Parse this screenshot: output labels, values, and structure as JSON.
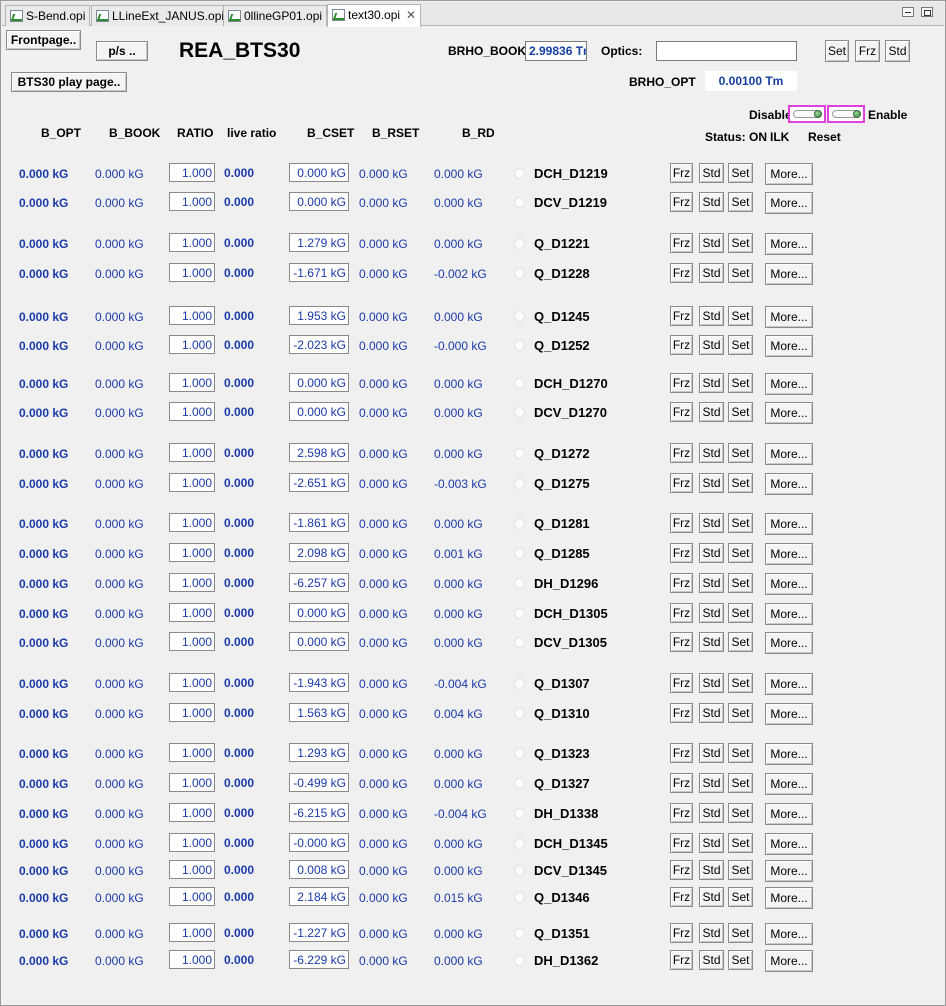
{
  "tabs": [
    {
      "label": "S-Bend.opi"
    },
    {
      "label": "LLineExt_JANUS.opi"
    },
    {
      "label": "0llineGP01.opi"
    },
    {
      "label": "text30.opi"
    }
  ],
  "header": {
    "frontpage_label": "Frontpage..",
    "ps_label": "p/s ..",
    "title": "REA_BTS30",
    "play_page_label": "BTS30 play page..",
    "brho_book_label": "BRHO_BOOK",
    "brho_book_value": "2.99836 Tm",
    "optics_label": "Optics:",
    "optics_value": "",
    "set_label": "Set",
    "frz_label": "Frz",
    "std_label": "Std",
    "brho_opt_label": "BRHO_OPT",
    "brho_opt_value": "0.00100 Tm",
    "disable_label": "Disable",
    "enable_label": "Enable",
    "status_label": "Status: ON",
    "ilk_label": "ILK",
    "reset_label": "Reset"
  },
  "columns": [
    "B_OPT",
    "B_BOOK",
    "RATIO",
    "live ratio",
    "B_CSET",
    "B_RSET",
    "B_RD"
  ],
  "row_buttons": {
    "frz": "Frz",
    "std": "Std",
    "set": "Set",
    "more": "More..."
  },
  "rows": [
    {
      "b_opt": "0.000 kG",
      "b_book": "0.000 kG",
      "ratio": "1.000",
      "live": "0.000",
      "cset": "0.000 kG",
      "rset": "0.000 kG",
      "rd": "0.000 kG",
      "name": "DCH_D1219"
    },
    {
      "b_opt": "0.000 kG",
      "b_book": "0.000 kG",
      "ratio": "1.000",
      "live": "0.000",
      "cset": "0.000 kG",
      "rset": "0.000 kG",
      "rd": "0.000 kG",
      "name": "DCV_D1219"
    },
    {
      "b_opt": "0.000 kG",
      "b_book": "0.000 kG",
      "ratio": "1.000",
      "live": "0.000",
      "cset": "1.279 kG",
      "rset": "0.000 kG",
      "rd": "0.000 kG",
      "name": "Q_D1221"
    },
    {
      "b_opt": "0.000 kG",
      "b_book": "0.000 kG",
      "ratio": "1.000",
      "live": "0.000",
      "cset": "-1.671 kG",
      "rset": "0.000 kG",
      "rd": "-0.002 kG",
      "name": "Q_D1228"
    },
    {
      "b_opt": "0.000 kG",
      "b_book": "0.000 kG",
      "ratio": "1.000",
      "live": "0.000",
      "cset": "1.953 kG",
      "rset": "0.000 kG",
      "rd": "0.000 kG",
      "name": "Q_D1245"
    },
    {
      "b_opt": "0.000 kG",
      "b_book": "0.000 kG",
      "ratio": "1.000",
      "live": "0.000",
      "cset": "-2.023 kG",
      "rset": "0.000 kG",
      "rd": "-0.000 kG",
      "name": "Q_D1252"
    },
    {
      "b_opt": "0.000 kG",
      "b_book": "0.000 kG",
      "ratio": "1.000",
      "live": "0.000",
      "cset": "0.000 kG",
      "rset": "0.000 kG",
      "rd": "0.000 kG",
      "name": "DCH_D1270"
    },
    {
      "b_opt": "0.000 kG",
      "b_book": "0.000 kG",
      "ratio": "1.000",
      "live": "0.000",
      "cset": "0.000 kG",
      "rset": "0.000 kG",
      "rd": "0.000 kG",
      "name": "DCV_D1270"
    },
    {
      "b_opt": "0.000 kG",
      "b_book": "0.000 kG",
      "ratio": "1.000",
      "live": "0.000",
      "cset": "2.598 kG",
      "rset": "0.000 kG",
      "rd": "0.000 kG",
      "name": "Q_D1272"
    },
    {
      "b_opt": "0.000 kG",
      "b_book": "0.000 kG",
      "ratio": "1.000",
      "live": "0.000",
      "cset": "-2.651 kG",
      "rset": "0.000 kG",
      "rd": "-0.003 kG",
      "name": "Q_D1275"
    },
    {
      "b_opt": "0.000 kG",
      "b_book": "0.000 kG",
      "ratio": "1.000",
      "live": "0.000",
      "cset": "-1.861 kG",
      "rset": "0.000 kG",
      "rd": "0.000 kG",
      "name": "Q_D1281"
    },
    {
      "b_opt": "0.000 kG",
      "b_book": "0.000 kG",
      "ratio": "1.000",
      "live": "0.000",
      "cset": "2.098 kG",
      "rset": "0.000 kG",
      "rd": "0.001 kG",
      "name": "Q_D1285"
    },
    {
      "b_opt": "0.000 kG",
      "b_book": "0.000 kG",
      "ratio": "1.000",
      "live": "0.000",
      "cset": "-6.257 kG",
      "rset": "0.000 kG",
      "rd": "0.000 kG",
      "name": "DH_D1296"
    },
    {
      "b_opt": "0.000 kG",
      "b_book": "0.000 kG",
      "ratio": "1.000",
      "live": "0.000",
      "cset": "0.000 kG",
      "rset": "0.000 kG",
      "rd": "0.000 kG",
      "name": "DCH_D1305"
    },
    {
      "b_opt": "0.000 kG",
      "b_book": "0.000 kG",
      "ratio": "1.000",
      "live": "0.000",
      "cset": "0.000 kG",
      "rset": "0.000 kG",
      "rd": "0.000 kG",
      "name": "DCV_D1305"
    },
    {
      "b_opt": "0.000 kG",
      "b_book": "0.000 kG",
      "ratio": "1.000",
      "live": "0.000",
      "cset": "-1.943 kG",
      "rset": "0.000 kG",
      "rd": "-0.004 kG",
      "name": "Q_D1307"
    },
    {
      "b_opt": "0.000 kG",
      "b_book": "0.000 kG",
      "ratio": "1.000",
      "live": "0.000",
      "cset": "1.563 kG",
      "rset": "0.000 kG",
      "rd": "0.004 kG",
      "name": "Q_D1310"
    },
    {
      "b_opt": "0.000 kG",
      "b_book": "0.000 kG",
      "ratio": "1.000",
      "live": "0.000",
      "cset": "1.293 kG",
      "rset": "0.000 kG",
      "rd": "0.000 kG",
      "name": "Q_D1323"
    },
    {
      "b_opt": "0.000 kG",
      "b_book": "0.000 kG",
      "ratio": "1.000",
      "live": "0.000",
      "cset": "-0.499 kG",
      "rset": "0.000 kG",
      "rd": "0.000 kG",
      "name": "Q_D1327"
    },
    {
      "b_opt": "0.000 kG",
      "b_book": "0.000 kG",
      "ratio": "1.000",
      "live": "0.000",
      "cset": "-6.215 kG",
      "rset": "0.000 kG",
      "rd": "-0.004 kG",
      "name": "DH_D1338"
    },
    {
      "b_opt": "0.000 kG",
      "b_book": "0.000 kG",
      "ratio": "1.000",
      "live": "0.000",
      "cset": "-0.000 kG",
      "rset": "0.000 kG",
      "rd": "0.000 kG",
      "name": "DCH_D1345"
    },
    {
      "b_opt": "0.000 kG",
      "b_book": "0.000 kG",
      "ratio": "1.000",
      "live": "0.000",
      "cset": "0.008 kG",
      "rset": "0.000 kG",
      "rd": "0.000 kG",
      "name": "DCV_D1345"
    },
    {
      "b_opt": "0.000 kG",
      "b_book": "0.000 kG",
      "ratio": "1.000",
      "live": "0.000",
      "cset": "2.184 kG",
      "rset": "0.000 kG",
      "rd": "0.015 kG",
      "name": "Q_D1346"
    },
    {
      "b_opt": "0.000 kG",
      "b_book": "0.000 kG",
      "ratio": "1.000",
      "live": "0.000",
      "cset": "-1.227 kG",
      "rset": "0.000 kG",
      "rd": "0.000 kG",
      "name": "Q_D1351"
    },
    {
      "b_opt": "0.000 kG",
      "b_book": "0.000 kG",
      "ratio": "1.000",
      "live": "0.000",
      "cset": "-6.229 kG",
      "rset": "0.000 kG",
      "rd": "0.000 kG",
      "name": "DH_D1362"
    }
  ]
}
